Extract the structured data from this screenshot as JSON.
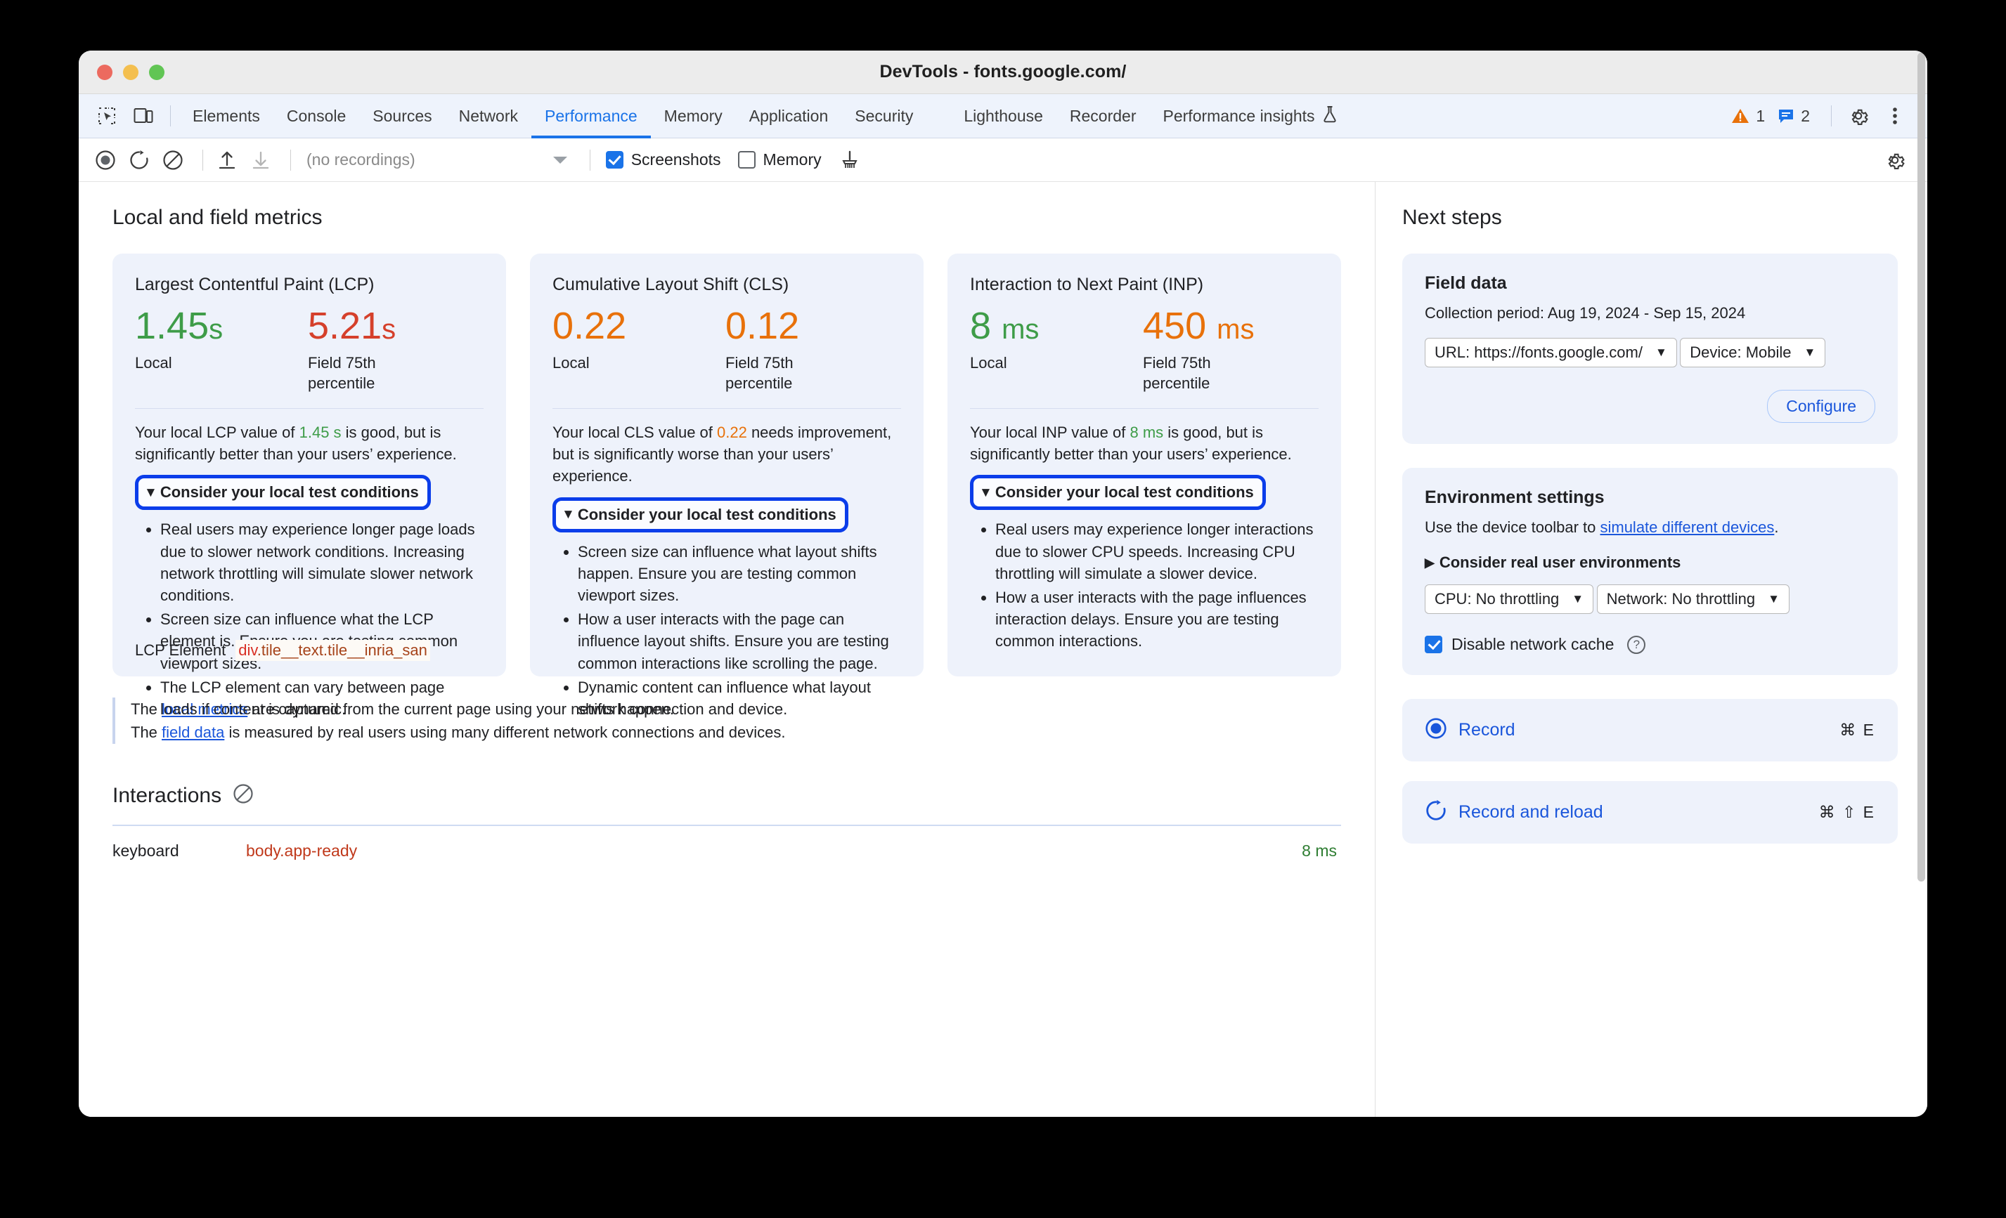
{
  "window": {
    "title": "DevTools - fonts.google.com/"
  },
  "tabs": [
    {
      "label": "Elements",
      "active": false
    },
    {
      "label": "Console",
      "active": false
    },
    {
      "label": "Sources",
      "active": false
    },
    {
      "label": "Network",
      "active": false
    },
    {
      "label": "Performance",
      "active": true
    },
    {
      "label": "Memory",
      "active": false
    },
    {
      "label": "Application",
      "active": false
    },
    {
      "label": "Security",
      "active": false
    },
    {
      "label": "Lighthouse",
      "active": false
    },
    {
      "label": "Recorder",
      "active": false
    },
    {
      "label": "Performance insights",
      "active": false
    }
  ],
  "tabbar": {
    "warning_count": "1",
    "info_count": "2",
    "icons": [
      "inspect-icon",
      "device-toolbar-icon",
      "flask-icon",
      "warning-icon",
      "info-icon",
      "gear-icon",
      "more-icon"
    ]
  },
  "toolbar": {
    "recordings_label": "(no recordings)",
    "screenshots_label": "Screenshots",
    "screenshots_checked": true,
    "memory_label": "Memory",
    "memory_checked": false,
    "icons": [
      "record-icon",
      "record-reload-icon",
      "clear-icon",
      "upload-icon",
      "download-icon",
      "dropdown-caret-icon",
      "broom-icon",
      "settings-gear-icon"
    ]
  },
  "main": {
    "title": "Local and field metrics",
    "cards": [
      {
        "id": "lcp",
        "title": "Largest Contentful Paint (LCP)",
        "local_value": "1.45 s",
        "local_number": "1.45",
        "local_unit": "s",
        "local_status": "good",
        "local_label": "Local",
        "field_value": "5.21 s",
        "field_number": "5.21",
        "field_unit": "s",
        "field_status": "bad",
        "field_label": "Field 75th percentile",
        "description_pre": "Your local LCP value of ",
        "description_value": "1.45 s",
        "description_post": " is good, but is significantly better than your users’ experience.",
        "summary_label": "Consider your local test conditions",
        "expanded": true,
        "bullets": [
          "Real users may experience longer page loads due to slower network conditions. Increasing network throttling will simulate slower network conditions.",
          "Screen size can influence what the LCP element is. Ensure you are testing common viewport sizes.",
          "The LCP element can vary between page loads if content is dynamic."
        ],
        "element_label": "LCP Element",
        "element_tag": "div",
        "element_classes": ".tile__text.tile__inria_san"
      },
      {
        "id": "cls",
        "title": "Cumulative Layout Shift (CLS)",
        "local_value": "0.22",
        "local_number": "0.22",
        "local_unit": "",
        "local_status": "mid",
        "local_label": "Local",
        "field_value": "0.12",
        "field_number": "0.12",
        "field_unit": "",
        "field_status": "mid",
        "field_label": "Field 75th percentile",
        "description_pre": "Your local CLS value of ",
        "description_value": "0.22",
        "description_post": " needs improvement, but is significantly worse than your users’ experience.",
        "summary_label": "Consider your local test conditions",
        "expanded": true,
        "bullets": [
          "Screen size can influence what layout shifts happen. Ensure you are testing common viewport sizes.",
          "How a user interacts with the page can influence layout shifts. Ensure you are testing common interactions like scrolling the page.",
          "Dynamic content can influence what layout shifts happen."
        ]
      },
      {
        "id": "inp",
        "title": "Interaction to Next Paint (INP)",
        "local_value": "8 ms",
        "local_number": "8",
        "local_unit": "ms",
        "local_status": "good",
        "local_label": "Local",
        "field_value": "450 ms",
        "field_number": "450",
        "field_unit": "ms",
        "field_status": "mid",
        "field_label": "Field 75th percentile",
        "description_pre": "Your local INP value of ",
        "description_value": "8 ms",
        "description_post": " is good, but is significantly better than your users’ experience.",
        "summary_label": "Consider your local test conditions",
        "expanded": true,
        "bullets": [
          "Real users may experience longer interactions due to slower CPU speeds. Increasing CPU throttling will simulate a slower device.",
          "How a user interacts with the page influences interaction delays. Ensure you are testing common interactions."
        ]
      }
    ],
    "footnote": {
      "line1_pre": "The ",
      "line1_link": "local metrics",
      "line1_post": " are captured from the current page using your network connection and device.",
      "line2_pre": "The ",
      "line2_link": "field data",
      "line2_post": " is measured by real users using many different network connections and devices."
    },
    "interactions": {
      "title": "Interactions",
      "clear_icon": "clear-icon",
      "rows": [
        {
          "type": "keyboard",
          "selector": "body.app-ready",
          "duration": "8 ms"
        }
      ]
    }
  },
  "sidebar": {
    "title": "Next steps",
    "field_data": {
      "heading": "Field data",
      "collection_period": "Collection period: Aug 19, 2024 - Sep 15, 2024",
      "url_select": "URL: https://fonts.google.com/",
      "device_select": "Device: Mobile",
      "configure_label": "Configure"
    },
    "environment": {
      "heading": "Environment settings",
      "desc_pre": "Use the device toolbar to ",
      "desc_link": "simulate different devices",
      "desc_post": ".",
      "disclosure_label": "Consider real user environments",
      "cpu_select": "CPU: No throttling",
      "network_select": "Network: No throttling",
      "cache_label": "Disable network cache",
      "cache_checked": true,
      "help_icon": "help-icon"
    },
    "actions": [
      {
        "icon": "record-icon",
        "label": "Record",
        "shortcut": "⌘ E"
      },
      {
        "icon": "record-reload-icon",
        "label": "Record and reload",
        "shortcut": "⌘ ⇧ E"
      }
    ]
  },
  "colors": {
    "accent": "#1a73e8",
    "good": "#3e9c48",
    "needs_improvement": "#e8710a",
    "poor": "#d5402b",
    "highlight_border": "#0b3dea",
    "card_bg": "#eef2fb"
  }
}
